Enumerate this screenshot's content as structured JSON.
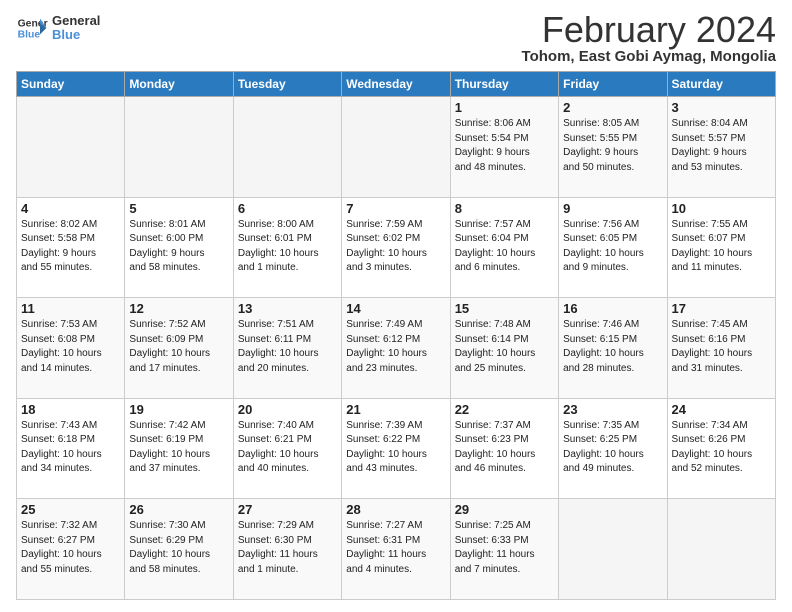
{
  "logo": {
    "line1": "General",
    "line2": "Blue"
  },
  "title": "February 2024",
  "subtitle": "Tohom, East Gobi Aymag, Mongolia",
  "days_header": [
    "Sunday",
    "Monday",
    "Tuesday",
    "Wednesday",
    "Thursday",
    "Friday",
    "Saturday"
  ],
  "weeks": [
    [
      {
        "num": "",
        "info": ""
      },
      {
        "num": "",
        "info": ""
      },
      {
        "num": "",
        "info": ""
      },
      {
        "num": "",
        "info": ""
      },
      {
        "num": "1",
        "info": "Sunrise: 8:06 AM\nSunset: 5:54 PM\nDaylight: 9 hours\nand 48 minutes."
      },
      {
        "num": "2",
        "info": "Sunrise: 8:05 AM\nSunset: 5:55 PM\nDaylight: 9 hours\nand 50 minutes."
      },
      {
        "num": "3",
        "info": "Sunrise: 8:04 AM\nSunset: 5:57 PM\nDaylight: 9 hours\nand 53 minutes."
      }
    ],
    [
      {
        "num": "4",
        "info": "Sunrise: 8:02 AM\nSunset: 5:58 PM\nDaylight: 9 hours\nand 55 minutes."
      },
      {
        "num": "5",
        "info": "Sunrise: 8:01 AM\nSunset: 6:00 PM\nDaylight: 9 hours\nand 58 minutes."
      },
      {
        "num": "6",
        "info": "Sunrise: 8:00 AM\nSunset: 6:01 PM\nDaylight: 10 hours\nand 1 minute."
      },
      {
        "num": "7",
        "info": "Sunrise: 7:59 AM\nSunset: 6:02 PM\nDaylight: 10 hours\nand 3 minutes."
      },
      {
        "num": "8",
        "info": "Sunrise: 7:57 AM\nSunset: 6:04 PM\nDaylight: 10 hours\nand 6 minutes."
      },
      {
        "num": "9",
        "info": "Sunrise: 7:56 AM\nSunset: 6:05 PM\nDaylight: 10 hours\nand 9 minutes."
      },
      {
        "num": "10",
        "info": "Sunrise: 7:55 AM\nSunset: 6:07 PM\nDaylight: 10 hours\nand 11 minutes."
      }
    ],
    [
      {
        "num": "11",
        "info": "Sunrise: 7:53 AM\nSunset: 6:08 PM\nDaylight: 10 hours\nand 14 minutes."
      },
      {
        "num": "12",
        "info": "Sunrise: 7:52 AM\nSunset: 6:09 PM\nDaylight: 10 hours\nand 17 minutes."
      },
      {
        "num": "13",
        "info": "Sunrise: 7:51 AM\nSunset: 6:11 PM\nDaylight: 10 hours\nand 20 minutes."
      },
      {
        "num": "14",
        "info": "Sunrise: 7:49 AM\nSunset: 6:12 PM\nDaylight: 10 hours\nand 23 minutes."
      },
      {
        "num": "15",
        "info": "Sunrise: 7:48 AM\nSunset: 6:14 PM\nDaylight: 10 hours\nand 25 minutes."
      },
      {
        "num": "16",
        "info": "Sunrise: 7:46 AM\nSunset: 6:15 PM\nDaylight: 10 hours\nand 28 minutes."
      },
      {
        "num": "17",
        "info": "Sunrise: 7:45 AM\nSunset: 6:16 PM\nDaylight: 10 hours\nand 31 minutes."
      }
    ],
    [
      {
        "num": "18",
        "info": "Sunrise: 7:43 AM\nSunset: 6:18 PM\nDaylight: 10 hours\nand 34 minutes."
      },
      {
        "num": "19",
        "info": "Sunrise: 7:42 AM\nSunset: 6:19 PM\nDaylight: 10 hours\nand 37 minutes."
      },
      {
        "num": "20",
        "info": "Sunrise: 7:40 AM\nSunset: 6:21 PM\nDaylight: 10 hours\nand 40 minutes."
      },
      {
        "num": "21",
        "info": "Sunrise: 7:39 AM\nSunset: 6:22 PM\nDaylight: 10 hours\nand 43 minutes."
      },
      {
        "num": "22",
        "info": "Sunrise: 7:37 AM\nSunset: 6:23 PM\nDaylight: 10 hours\nand 46 minutes."
      },
      {
        "num": "23",
        "info": "Sunrise: 7:35 AM\nSunset: 6:25 PM\nDaylight: 10 hours\nand 49 minutes."
      },
      {
        "num": "24",
        "info": "Sunrise: 7:34 AM\nSunset: 6:26 PM\nDaylight: 10 hours\nand 52 minutes."
      }
    ],
    [
      {
        "num": "25",
        "info": "Sunrise: 7:32 AM\nSunset: 6:27 PM\nDaylight: 10 hours\nand 55 minutes."
      },
      {
        "num": "26",
        "info": "Sunrise: 7:30 AM\nSunset: 6:29 PM\nDaylight: 10 hours\nand 58 minutes."
      },
      {
        "num": "27",
        "info": "Sunrise: 7:29 AM\nSunset: 6:30 PM\nDaylight: 11 hours\nand 1 minute."
      },
      {
        "num": "28",
        "info": "Sunrise: 7:27 AM\nSunset: 6:31 PM\nDaylight: 11 hours\nand 4 minutes."
      },
      {
        "num": "29",
        "info": "Sunrise: 7:25 AM\nSunset: 6:33 PM\nDaylight: 11 hours\nand 7 minutes."
      },
      {
        "num": "",
        "info": ""
      },
      {
        "num": "",
        "info": ""
      }
    ]
  ]
}
